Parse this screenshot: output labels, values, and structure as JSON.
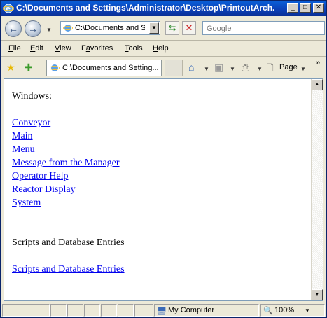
{
  "window": {
    "title": "C:\\Documents and Settings\\Administrator\\Desktop\\PrintoutArch...",
    "minimize": "_",
    "maximize": "□",
    "close": "✕"
  },
  "address": {
    "value": "C:\\Documents and Set",
    "refresh_icon": "refresh-icon",
    "stop_icon": "stop-icon"
  },
  "search": {
    "placeholder": "Google"
  },
  "menu": [
    "File",
    "Edit",
    "View",
    "Favorites",
    "Tools",
    "Help"
  ],
  "menu_access_keys": [
    "F",
    "E",
    "V",
    "a",
    "T",
    "H"
  ],
  "toolbar": {
    "tab_title": "C:\\Documents and Setting...",
    "page_label": "Page",
    "overflow": "»"
  },
  "content": {
    "heading_windows": "Windows:",
    "window_links": [
      "Conveyor",
      "Main",
      "Menu",
      "Message from the Manager",
      "Operator Help",
      "Reactor Display",
      "System"
    ],
    "heading_scripts": "Scripts and Database Entries",
    "scripts_link": "Scripts and Database Entries"
  },
  "status": {
    "zone": "My Computer",
    "zoom": "100%"
  },
  "colors": {
    "titlebar": "#0b3fb5",
    "link": "#0000ee",
    "chrome": "#ece9d8"
  }
}
